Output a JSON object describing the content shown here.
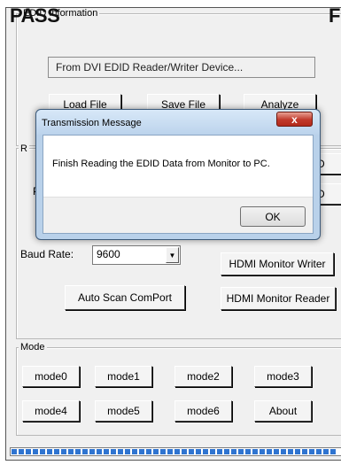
{
  "overlay": {
    "pass": "PASS",
    "right_letter": "F"
  },
  "edid_group": {
    "label": "EDID Information",
    "path_field": "From DVI EDID Reader/Writer Device...",
    "load_button": "Load File",
    "save_button": "Save File",
    "analyze_button": "Analyze"
  },
  "com_group": {
    "label_fragment": "R",
    "port_label_fragment": "P",
    "baud_label": "Baud Rate:",
    "baud_value": "9600",
    "auto_scan_button": "Auto Scan ComPort",
    "right_buttons_partial": [
      "D",
      "D"
    ],
    "hdmi_writer_button": "HDMI Monitor Writer",
    "hdmi_reader_button": "HDMI Monitor Reader"
  },
  "mode_group": {
    "label": "Mode",
    "buttons": [
      "mode0",
      "mode1",
      "mode2",
      "mode3",
      "mode4",
      "mode5",
      "mode6",
      "About"
    ]
  },
  "progress": {
    "fraction": 1.0
  },
  "dialog": {
    "title": "Transmission Message",
    "close_glyph": "x",
    "message": "Finish Reading the EDID Data from Monitor to PC.",
    "ok_button": "OK"
  },
  "colors": {
    "progress_fill": "#2f74d0",
    "close_button": "#c0392b"
  }
}
